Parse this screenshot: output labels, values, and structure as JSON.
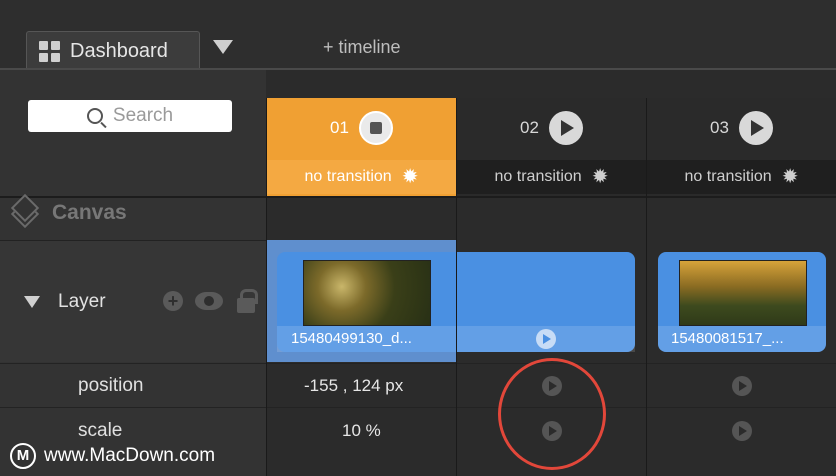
{
  "tabs": {
    "dashboard_label": "Dashboard",
    "add_timeline_label": "+ timeline"
  },
  "search": {
    "placeholder": "Search"
  },
  "canvas": {
    "label": "Canvas"
  },
  "layer": {
    "label": "Layer"
  },
  "properties": [
    {
      "label": "position"
    },
    {
      "label": "scale"
    }
  ],
  "columns": [
    {
      "number": "01",
      "transition": "no transition",
      "state": "playing"
    },
    {
      "number": "02",
      "transition": "no transition",
      "state": "stopped"
    },
    {
      "number": "03",
      "transition": "no transition",
      "state": "stopped"
    }
  ],
  "clips": [
    {
      "name": "15480499130_d..."
    },
    {
      "name": "15480081517_..."
    }
  ],
  "values": {
    "position": "-155 , 124 px",
    "scale": "10 %"
  },
  "watermark": {
    "text": "www.MacDown.com",
    "logo": "M"
  },
  "colors": {
    "active_column": "#f0a033",
    "clip_blue": "#4a90e2",
    "annotation_red": "#e2473a"
  }
}
